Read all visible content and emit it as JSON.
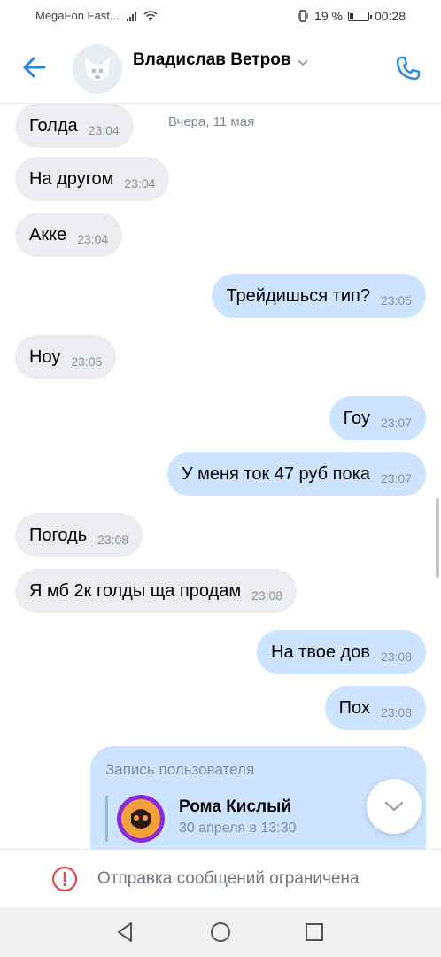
{
  "status_bar": {
    "carrier": "MegaFon Fast...",
    "battery_text": "19 %",
    "battery_level": 0.19,
    "time": "00:28"
  },
  "header": {
    "contact_name": "Владислав Ветров",
    "icons": [
      "back-arrow-icon",
      "chevron-down-icon",
      "phone-icon"
    ]
  },
  "messages": {
    "date_separator": "Вчера, 11 мая",
    "items": [
      {
        "dir": "in",
        "text": "Голда",
        "time": "23:04"
      },
      {
        "dir": "in",
        "text": "На другом",
        "time": "23:04"
      },
      {
        "dir": "in",
        "text": "Акке",
        "time": "23:04"
      },
      {
        "dir": "out",
        "text": "Трейдишься тип?",
        "time": "23:05"
      },
      {
        "dir": "in",
        "text": "Ноу",
        "time": "23:05"
      },
      {
        "dir": "out",
        "text": "Гоу",
        "time": "23:07"
      },
      {
        "dir": "out",
        "text": "У меня ток 47 руб пока",
        "time": "23:07"
      },
      {
        "dir": "in",
        "text": "Погодь",
        "time": "23:08"
      },
      {
        "dir": "in",
        "text": "Я мб 2к голды ща продам",
        "time": "23:08"
      },
      {
        "dir": "out",
        "text": "На твое дов",
        "time": "23:08"
      },
      {
        "dir": "out",
        "text": "Пох",
        "time": "23:08"
      }
    ],
    "post": {
      "title": "Запись пользователя",
      "author": "Рома Кислый",
      "date": "30 апреля в 13:30"
    }
  },
  "restriction": {
    "text": "Отправка сообщений ограничена",
    "color": "#e64646"
  },
  "colors": {
    "accent": "#2688eb",
    "incoming_bubble": "#ebedf0",
    "outgoing_bubble": "#cce4ff"
  }
}
